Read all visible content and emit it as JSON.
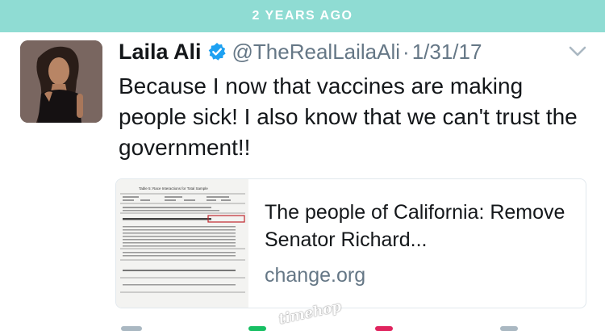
{
  "banner": {
    "label": "2 YEARS AGO"
  },
  "tweet": {
    "display_name": "Laila Ali",
    "handle": "@TheRealLailaAli",
    "separator": "·",
    "date": "1/31/17",
    "text": "Because I now that vaccines are making people sick! I also know that we can't trust the government!!"
  },
  "card": {
    "thumbnail_caption": "Table 5: Race Interactions for Total Sample",
    "title": "The people of California: Remove Senator Richard...",
    "domain": "change.org"
  },
  "watermark": {
    "label": "timehop"
  },
  "icons": {
    "verified": "verified-badge-icon",
    "more": "chevron-down-icon",
    "actions": [
      "reply-icon",
      "retweet-icon",
      "like-icon",
      "share-icon"
    ]
  },
  "colors": {
    "banner": "#8fdcd3",
    "verified": "#1da1f2",
    "secondary_text": "#657786",
    "retweet": "#17bf63",
    "like": "#e0245e"
  }
}
